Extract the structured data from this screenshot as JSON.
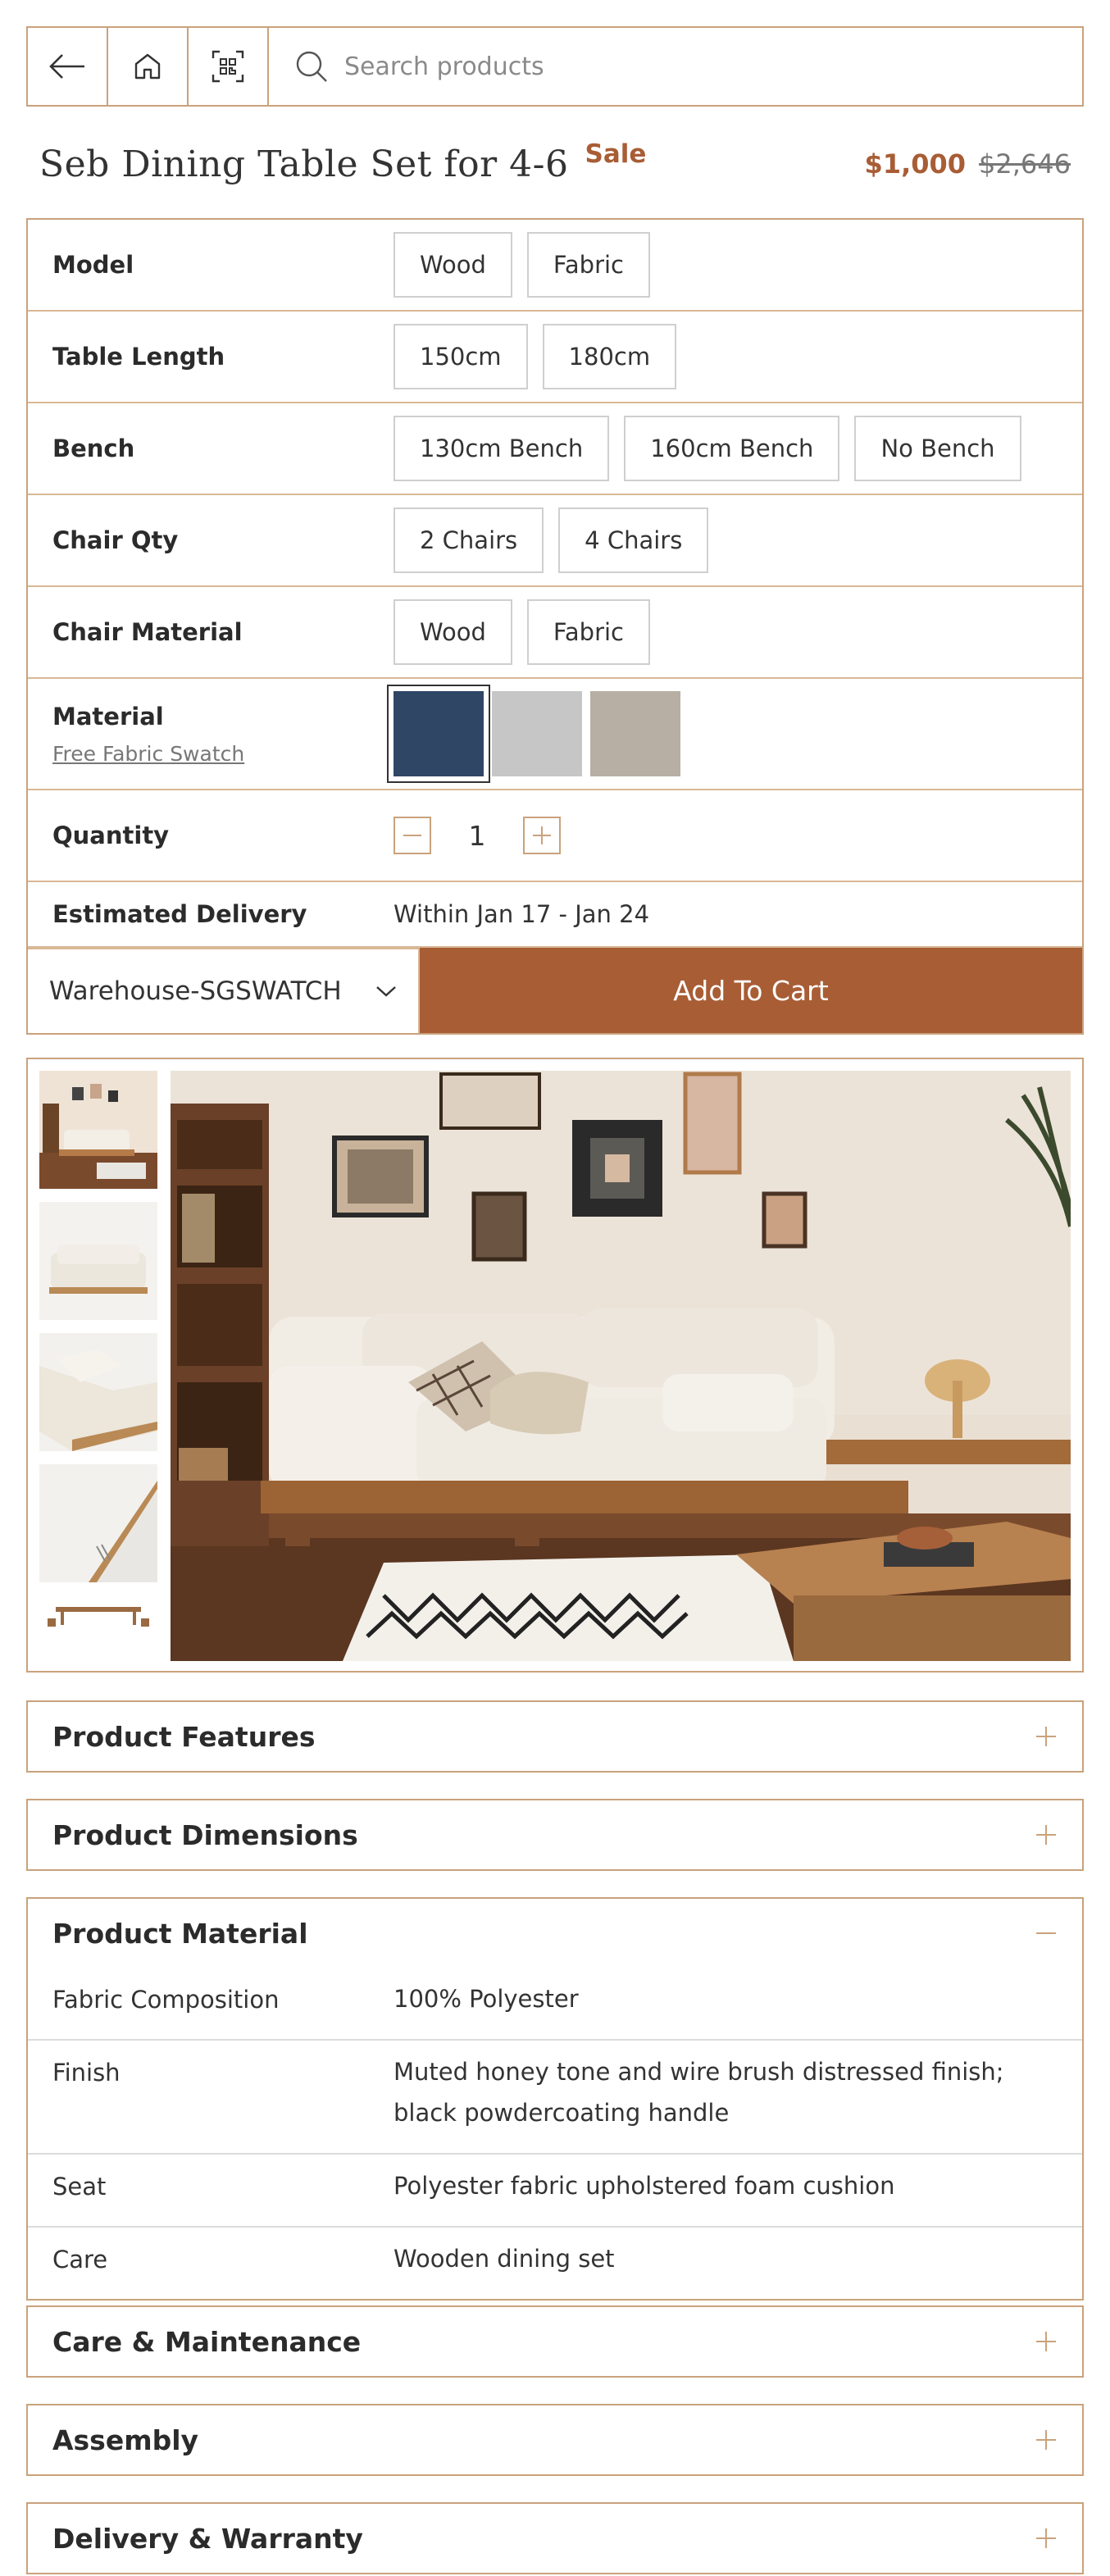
{
  "search": {
    "placeholder": "Search products"
  },
  "product": {
    "title": "Seb Dining Table Set for 4-6",
    "badge": "Sale",
    "price_now": "$1,000",
    "price_was": "$2,646"
  },
  "options": {
    "model": {
      "label": "Model",
      "values": [
        "Wood",
        "Fabric"
      ]
    },
    "table_length": {
      "label": "Table Length",
      "values": [
        "150cm",
        "180cm"
      ]
    },
    "bench": {
      "label": "Bench",
      "values": [
        "130cm Bench",
        "160cm Bench",
        "No Bench"
      ]
    },
    "chair_qty": {
      "label": "Chair Qty",
      "values": [
        "2 Chairs",
        "4 Chairs"
      ]
    },
    "chair_material": {
      "label": "Chair Material",
      "values": [
        "Wood",
        "Fabric"
      ]
    },
    "material": {
      "label": "Material",
      "link": "Free Fabric Swatch",
      "swatch_colors": [
        "#2f4665",
        "#c6c6c6",
        "#b7afa3"
      ]
    },
    "quantity": {
      "label": "Quantity",
      "value": "1"
    },
    "delivery": {
      "label": "Estimated Delivery",
      "value": "Within Jan 17 - Jan 24"
    }
  },
  "cart": {
    "warehouse": "Warehouse-SGSWATCH",
    "add_label": "Add To Cart"
  },
  "accordions": {
    "features": "Product Features",
    "dimensions": "Product Dimensions",
    "material": {
      "title": "Product Material",
      "rows": [
        {
          "k": "Fabric Composition",
          "v": "100% Polyester"
        },
        {
          "k": "Finish",
          "v": "Muted honey tone and wire brush distressed finish; black powdercoating handle"
        },
        {
          "k": "Seat",
          "v": "Polyester fabric upholstered foam cushion"
        },
        {
          "k": "Care",
          "v": "Wooden dining set"
        }
      ]
    },
    "care": "Care & Maintenance",
    "assembly": "Assembly",
    "delivery": "Delivery & Warranty"
  },
  "colors": {
    "accent": "#a85d35",
    "border": "#c9a27c"
  }
}
